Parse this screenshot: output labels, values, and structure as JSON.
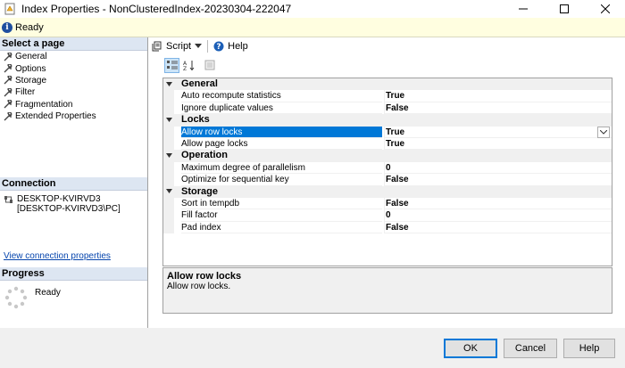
{
  "window": {
    "title": "Index Properties - NonClusteredIndex-20230304-222047",
    "minimize_icon": "minimize-icon",
    "maximize_icon": "maximize-icon",
    "close_icon": "close-icon"
  },
  "status": {
    "text": "Ready",
    "icon": "info-icon"
  },
  "select_page": {
    "header": "Select a page",
    "items": [
      {
        "label": "General"
      },
      {
        "label": "Options"
      },
      {
        "label": "Storage"
      },
      {
        "label": "Filter"
      },
      {
        "label": "Fragmentation"
      },
      {
        "label": "Extended Properties"
      }
    ]
  },
  "connection": {
    "header": "Connection",
    "server": "DESKTOP-KVIRVD3",
    "user": "[DESKTOP-KVIRVD3\\PC]",
    "link": "View connection properties"
  },
  "progress": {
    "header": "Progress",
    "status": "Ready"
  },
  "toolbar": {
    "script_label": "Script",
    "help_label": "Help"
  },
  "grid": {
    "rows": [
      {
        "type": "cat",
        "name": "General"
      },
      {
        "type": "prop",
        "name": "Auto recompute statistics",
        "value": "True"
      },
      {
        "type": "prop",
        "name": "Ignore duplicate values",
        "value": "False"
      },
      {
        "type": "cat",
        "name": "Locks"
      },
      {
        "type": "prop",
        "name": "Allow row locks",
        "value": "True",
        "selected": true
      },
      {
        "type": "prop",
        "name": "Allow page locks",
        "value": "True"
      },
      {
        "type": "cat",
        "name": "Operation"
      },
      {
        "type": "prop",
        "name": "Maximum degree of parallelism",
        "value": "0"
      },
      {
        "type": "prop",
        "name": "Optimize for sequential key",
        "value": "False"
      },
      {
        "type": "cat",
        "name": "Storage"
      },
      {
        "type": "prop",
        "name": "Sort in tempdb",
        "value": "False"
      },
      {
        "type": "prop",
        "name": "Fill factor",
        "value": "0"
      },
      {
        "type": "prop",
        "name": "Pad index",
        "value": "False"
      }
    ]
  },
  "description": {
    "title": "Allow row locks",
    "text": "Allow row locks."
  },
  "buttons": {
    "ok": "OK",
    "cancel": "Cancel",
    "help": "Help"
  }
}
